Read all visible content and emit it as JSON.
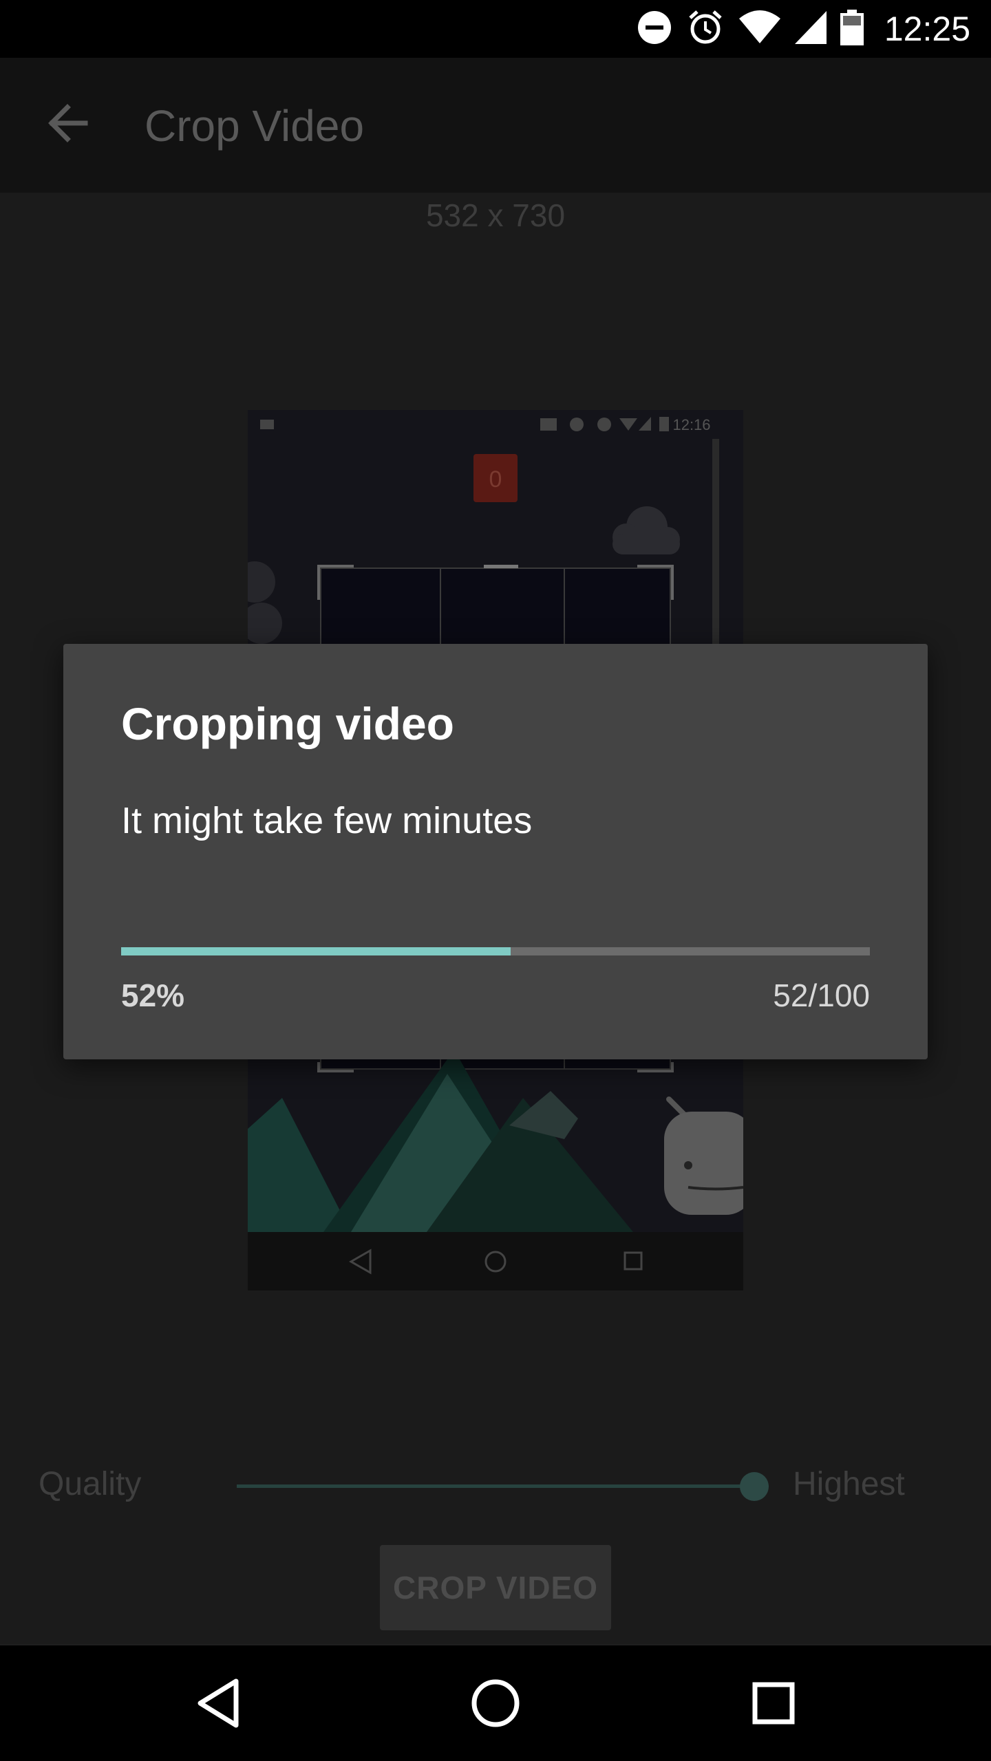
{
  "status_bar": {
    "time": "12:25",
    "icons": [
      "do-not-disturb-icon",
      "alarm-icon",
      "wifi-icon",
      "signal-icon",
      "battery-icon"
    ]
  },
  "app_bar": {
    "title": "Crop Video",
    "back_icon": "back-arrow-icon"
  },
  "preview": {
    "dimensions": "532 x 730",
    "video_status_time": "12:16",
    "video_score": "0"
  },
  "quality": {
    "label": "Quality",
    "value": "Highest",
    "level": 1.0
  },
  "crop_button": {
    "label": "CROP VIDEO"
  },
  "dialog": {
    "title": "Cropping video",
    "message": "It might take few minutes",
    "progress": {
      "value": 52,
      "max": 100,
      "percent_text": "52%",
      "count_text": "52/100"
    },
    "accent_color": "#80cbc4"
  },
  "nav_bar": {
    "icons": [
      "back-triangle-icon",
      "home-circle-icon",
      "recents-square-icon"
    ]
  }
}
